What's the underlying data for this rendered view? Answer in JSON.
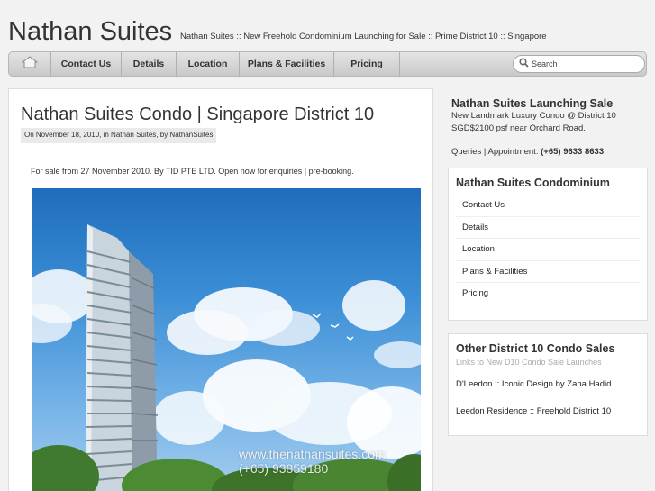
{
  "header": {
    "site_title": "Nathan Suites",
    "tagline": "Nathan Suites :: New Freehold Condominium Launching for Sale :: Prime District 10 :: Singapore"
  },
  "nav": {
    "home_icon": "home-icon",
    "items": [
      {
        "label": "Contact Us"
      },
      {
        "label": "Details"
      },
      {
        "label": "Location"
      },
      {
        "label": "Plans & Facilities"
      },
      {
        "label": "Pricing"
      }
    ],
    "search_placeholder": "Search",
    "search_icon": "search-icon"
  },
  "post": {
    "title": "Nathan Suites Condo | Singapore District 10",
    "meta": "On November 18, 2010, in Nathan Suites, by NathanSuites",
    "intro": "For sale from 27 November 2010.  By TID PTE LTD.  Open now for enquiries | pre-booking.",
    "image_watermark_url": "www.thenathansuites.com",
    "image_watermark_phone": "(+65) 93859180"
  },
  "sidebar": {
    "intro_title": "Nathan Suites Launching Sale",
    "intro_line1": "New Landmark Luxury Condo @ District 10",
    "intro_line2": "SGD$2100 psf near Orchard Road.",
    "contact_prefix": "Queries | Appointment: ",
    "contact_phone": "(+65) 9633 8633",
    "widget1": {
      "title": "Nathan Suites Condominium",
      "links": [
        {
          "label": "Contact Us"
        },
        {
          "label": "Details"
        },
        {
          "label": "Location"
        },
        {
          "label": "Plans & Facilities"
        },
        {
          "label": "Pricing"
        }
      ]
    },
    "widget2": {
      "title": "Other District 10 Condo Sales",
      "subtitle": "Links to New D10 Condo Sale Launches",
      "links": [
        {
          "label": "D'Leedon :: Iconic Design by Zaha Hadid"
        },
        {
          "label": "Leedon Residence :: Freehold District 10"
        }
      ]
    }
  }
}
